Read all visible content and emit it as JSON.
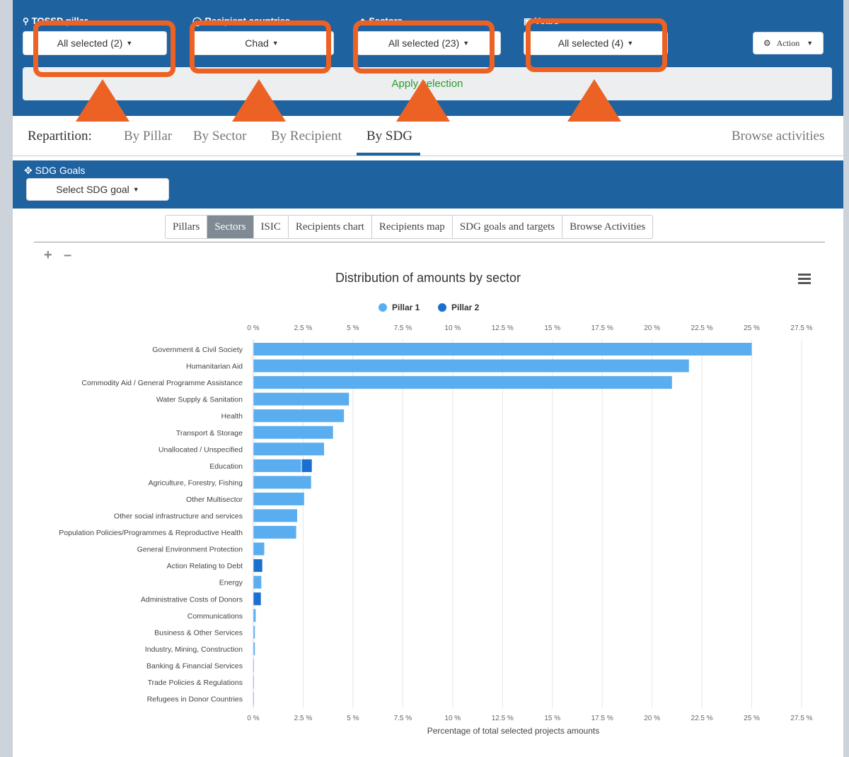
{
  "filters": [
    {
      "label": "TOSSD pillar",
      "value": "All selected (2)"
    },
    {
      "label": "Recipient countries",
      "value": "Chad"
    },
    {
      "label": "Sectors",
      "value": "All selected (23)"
    },
    {
      "label": "Years",
      "value": "All selected (4)"
    }
  ],
  "action_label": "Action",
  "apply_label": "Apply selection",
  "repartition": {
    "label": "Repartition:",
    "items": [
      "By Pillar",
      "By Sector",
      "By Recipient",
      "By SDG"
    ],
    "active": "By SDG",
    "browse": "Browse activities"
  },
  "sdg": {
    "label": "SDG Goals",
    "select": "Select SDG goal"
  },
  "tabs": [
    "Pillars",
    "Sectors",
    "ISIC",
    "Recipients chart",
    "Recipients map",
    "SDG goals and targets",
    "Browse Activities"
  ],
  "selected_tab": "Sectors",
  "colors": {
    "brand": "#1f62a0",
    "pillar1": "#5aaef0",
    "pillar2": "#1a6fcf",
    "highlight": "#ec6224",
    "apply": "#2d9a2d"
  },
  "chart_data": {
    "type": "bar",
    "orientation": "horizontal",
    "stacked": true,
    "title": "Distribution of amounts by sector",
    "xlabel": "Percentage of total selected projects amounts",
    "xlim": [
      0,
      27.5
    ],
    "xticks": [
      "0 %",
      "2.5 %",
      "5 %",
      "7.5 %",
      "10 %",
      "12.5 %",
      "15 %",
      "17.5 %",
      "20 %",
      "22.5 %",
      "25 %",
      "27.5 %"
    ],
    "legend_position": "top",
    "grid": true,
    "categories": [
      "Government & Civil Society",
      "Humanitarian Aid",
      "Commodity Aid / General Programme Assistance",
      "Water Supply & Sanitation",
      "Health",
      "Transport & Storage",
      "Unallocated / Unspecified",
      "Education",
      "Agriculture, Forestry, Fishing",
      "Other Multisector",
      "Other social infrastructure and services",
      "Population Policies/Programmes & Reproductive Health",
      "General Environment Protection",
      "Action Relating to Debt",
      "Energy",
      "Administrative Costs of Donors",
      "Communications",
      "Business & Other Services",
      "Industry, Mining, Construction",
      "Banking & Financial Services",
      "Trade Policies & Regulations",
      "Refugees in Donor Countries"
    ],
    "series": [
      {
        "name": "Pillar 1",
        "values": [
          25.0,
          21.85,
          21.0,
          4.8,
          4.55,
          4.0,
          3.55,
          2.4,
          2.9,
          2.55,
          2.2,
          2.15,
          0.55,
          0.0,
          0.4,
          0.0,
          0.12,
          0.08,
          0.08,
          0.02,
          0.02,
          0.01
        ]
      },
      {
        "name": "Pillar 2",
        "values": [
          0.0,
          0.0,
          0.0,
          0.0,
          0.0,
          0.0,
          0.0,
          0.5,
          0.0,
          0.0,
          0.0,
          0.0,
          0.0,
          0.45,
          0.0,
          0.38,
          0.0,
          0.0,
          0.0,
          0.0,
          0.0,
          0.0
        ]
      }
    ]
  }
}
